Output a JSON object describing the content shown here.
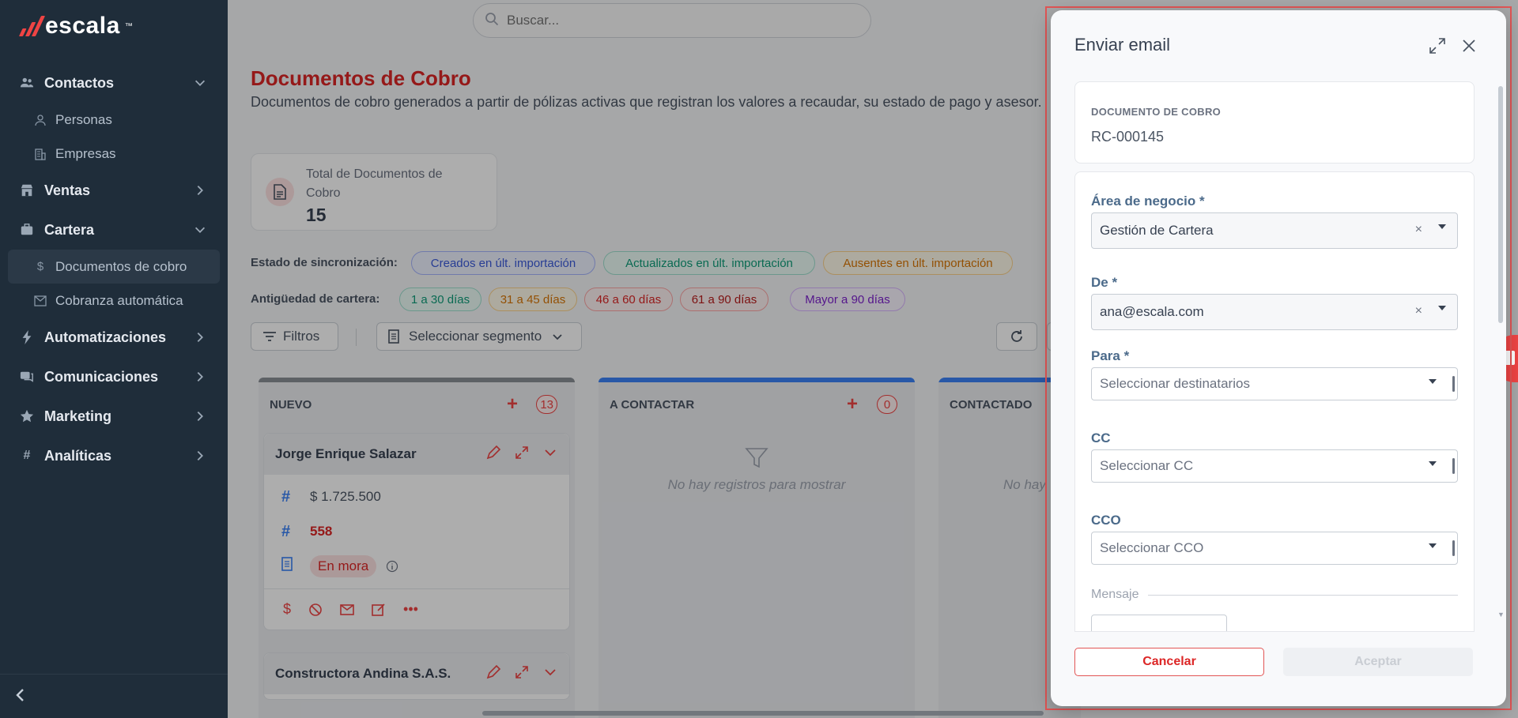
{
  "brand": {
    "name": "escala",
    "tm": "™"
  },
  "search": {
    "placeholder": "Buscar..."
  },
  "sidebar": {
    "items": [
      {
        "label": "Contactos",
        "icon": "users-icon"
      },
      {
        "label": "Personas",
        "icon": "person-icon"
      },
      {
        "label": "Empresas",
        "icon": "building-icon"
      },
      {
        "label": "Ventas",
        "icon": "store-icon"
      },
      {
        "label": "Cartera",
        "icon": "briefcase-icon"
      },
      {
        "label": "Documentos de cobro",
        "icon": "dollar-icon"
      },
      {
        "label": "Cobranza automática",
        "icon": "mail-icon"
      },
      {
        "label": "Automatizaciones",
        "icon": "bolt-icon"
      },
      {
        "label": "Comunicaciones",
        "icon": "chat-icon"
      },
      {
        "label": "Marketing",
        "icon": "star-icon"
      },
      {
        "label": "Analíticas",
        "icon": "hash-icon"
      }
    ]
  },
  "page": {
    "title": "Documentos de Cobro",
    "description": "Documentos de cobro generados a partir de pólizas activas que registran los valores a recaudar, su estado de pago y asesor.",
    "stat_label": "Total de Documentos de Cobro",
    "stat_value": "15"
  },
  "sync": {
    "label": "Estado de sincronización:",
    "chips": [
      "Creados en últ. importación",
      "Actualizados en últ. importación",
      "Ausentes en últ. importación"
    ]
  },
  "aging": {
    "label": "Antigüedad de cartera:",
    "chips": [
      "1 a 30 días",
      "31 a 45 días",
      "46 a 60 días",
      "61 a 90 días",
      "Mayor a 90 días"
    ]
  },
  "toolbar": {
    "filters": "Filtros",
    "segment": "Seleccionar segmento"
  },
  "columns": [
    {
      "title": "NUEVO",
      "count": "13"
    },
    {
      "title": "A CONTACTAR",
      "count": "0",
      "empty": "No hay registros para mostrar"
    },
    {
      "title": "CONTACTADO",
      "empty": "No hay"
    }
  ],
  "cards": [
    {
      "name": "Jorge Enrique Salazar",
      "amount": "$ 1.725.500",
      "number": "558",
      "status": "En mora"
    },
    {
      "name": "Constructora Andina S.A.S."
    }
  ],
  "modal": {
    "title": "Enviar email",
    "doc_label": "DOCUMENTO DE COBRO",
    "doc_value": "RC-000145",
    "area_label": "Área de negocio *",
    "area_value": "Gestión de Cartera",
    "from_label": "De *",
    "from_value": "ana@escala.com",
    "to_label": "Para *",
    "to_placeholder": "Seleccionar destinatarios",
    "cc_label": "CC",
    "cc_placeholder": "Seleccionar CC",
    "cco_label": "CCO",
    "cco_placeholder": "Seleccionar CCO",
    "message_label": "Mensaje",
    "cancel": "Cancelar",
    "accept": "Aceptar"
  },
  "colors": {
    "accent": "#ef4444",
    "sidebar": "#1f2d3a"
  }
}
